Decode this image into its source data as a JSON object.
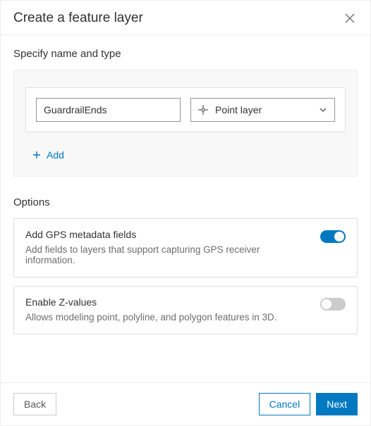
{
  "dialog": {
    "title": "Create a feature layer",
    "section1_title": "Specify name and type",
    "layer_name_value": "GuardrailEnds",
    "layer_type_selected": "Point layer",
    "add_label": "Add",
    "options_title": "Options",
    "options": [
      {
        "title": "Add GPS metadata fields",
        "desc": "Add fields to layers that support capturing GPS receiver information.",
        "on": true
      },
      {
        "title": "Enable Z-values",
        "desc": "Allows modeling point, polyline, and polygon features in 3D.",
        "on": false
      }
    ],
    "footer": {
      "back": "Back",
      "cancel": "Cancel",
      "next": "Next"
    }
  }
}
